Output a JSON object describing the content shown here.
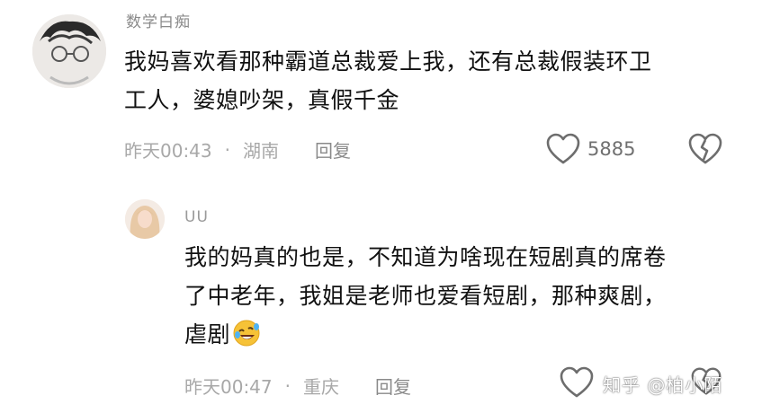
{
  "comment": {
    "username": "数学白痴",
    "text_line1": "我妈喜欢看那种霸道总裁爱上我，还有总裁假装环卫",
    "text_line2": "工人，婆媳吵架，真假千金",
    "time": "昨天00:43",
    "location": "湖南",
    "reply_label": "回复",
    "like_count": "5885",
    "icons": {
      "like": "heart-outline-icon",
      "dislike": "broken-heart-icon"
    }
  },
  "reply": {
    "username": "UU",
    "text_line1": "我的妈真的也是，不知道为啥现在短剧真的席卷",
    "text_line2": "了中老年，我姐是老师也爱看短剧，那种爽剧，",
    "text_line3": "虐剧",
    "emoji": "rolling-on-floor-laughing-emoji",
    "time": "昨天00:47",
    "location": "重庆",
    "reply_label": "回复"
  },
  "watermark": "知乎 @柏小陌",
  "colors": {
    "meta": "#a8a8a8",
    "text": "#111111",
    "icon": "#707070"
  }
}
